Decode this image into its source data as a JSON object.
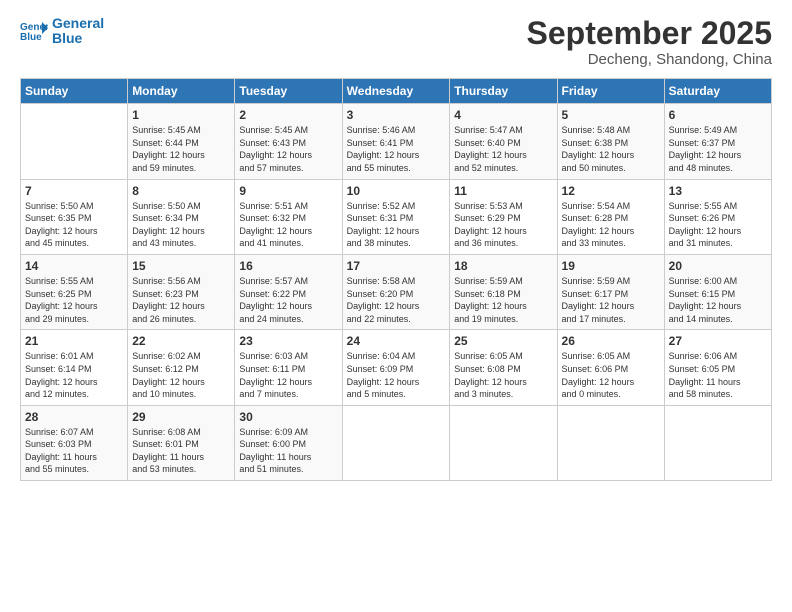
{
  "header": {
    "logo_line1": "General",
    "logo_line2": "Blue",
    "month": "September 2025",
    "location": "Decheng, Shandong, China"
  },
  "days_of_week": [
    "Sunday",
    "Monday",
    "Tuesday",
    "Wednesday",
    "Thursday",
    "Friday",
    "Saturday"
  ],
  "weeks": [
    [
      {
        "day": "",
        "info": ""
      },
      {
        "day": "1",
        "info": "Sunrise: 5:45 AM\nSunset: 6:44 PM\nDaylight: 12 hours\nand 59 minutes."
      },
      {
        "day": "2",
        "info": "Sunrise: 5:45 AM\nSunset: 6:43 PM\nDaylight: 12 hours\nand 57 minutes."
      },
      {
        "day": "3",
        "info": "Sunrise: 5:46 AM\nSunset: 6:41 PM\nDaylight: 12 hours\nand 55 minutes."
      },
      {
        "day": "4",
        "info": "Sunrise: 5:47 AM\nSunset: 6:40 PM\nDaylight: 12 hours\nand 52 minutes."
      },
      {
        "day": "5",
        "info": "Sunrise: 5:48 AM\nSunset: 6:38 PM\nDaylight: 12 hours\nand 50 minutes."
      },
      {
        "day": "6",
        "info": "Sunrise: 5:49 AM\nSunset: 6:37 PM\nDaylight: 12 hours\nand 48 minutes."
      }
    ],
    [
      {
        "day": "7",
        "info": "Sunrise: 5:50 AM\nSunset: 6:35 PM\nDaylight: 12 hours\nand 45 minutes."
      },
      {
        "day": "8",
        "info": "Sunrise: 5:50 AM\nSunset: 6:34 PM\nDaylight: 12 hours\nand 43 minutes."
      },
      {
        "day": "9",
        "info": "Sunrise: 5:51 AM\nSunset: 6:32 PM\nDaylight: 12 hours\nand 41 minutes."
      },
      {
        "day": "10",
        "info": "Sunrise: 5:52 AM\nSunset: 6:31 PM\nDaylight: 12 hours\nand 38 minutes."
      },
      {
        "day": "11",
        "info": "Sunrise: 5:53 AM\nSunset: 6:29 PM\nDaylight: 12 hours\nand 36 minutes."
      },
      {
        "day": "12",
        "info": "Sunrise: 5:54 AM\nSunset: 6:28 PM\nDaylight: 12 hours\nand 33 minutes."
      },
      {
        "day": "13",
        "info": "Sunrise: 5:55 AM\nSunset: 6:26 PM\nDaylight: 12 hours\nand 31 minutes."
      }
    ],
    [
      {
        "day": "14",
        "info": "Sunrise: 5:55 AM\nSunset: 6:25 PM\nDaylight: 12 hours\nand 29 minutes."
      },
      {
        "day": "15",
        "info": "Sunrise: 5:56 AM\nSunset: 6:23 PM\nDaylight: 12 hours\nand 26 minutes."
      },
      {
        "day": "16",
        "info": "Sunrise: 5:57 AM\nSunset: 6:22 PM\nDaylight: 12 hours\nand 24 minutes."
      },
      {
        "day": "17",
        "info": "Sunrise: 5:58 AM\nSunset: 6:20 PM\nDaylight: 12 hours\nand 22 minutes."
      },
      {
        "day": "18",
        "info": "Sunrise: 5:59 AM\nSunset: 6:18 PM\nDaylight: 12 hours\nand 19 minutes."
      },
      {
        "day": "19",
        "info": "Sunrise: 5:59 AM\nSunset: 6:17 PM\nDaylight: 12 hours\nand 17 minutes."
      },
      {
        "day": "20",
        "info": "Sunrise: 6:00 AM\nSunset: 6:15 PM\nDaylight: 12 hours\nand 14 minutes."
      }
    ],
    [
      {
        "day": "21",
        "info": "Sunrise: 6:01 AM\nSunset: 6:14 PM\nDaylight: 12 hours\nand 12 minutes."
      },
      {
        "day": "22",
        "info": "Sunrise: 6:02 AM\nSunset: 6:12 PM\nDaylight: 12 hours\nand 10 minutes."
      },
      {
        "day": "23",
        "info": "Sunrise: 6:03 AM\nSunset: 6:11 PM\nDaylight: 12 hours\nand 7 minutes."
      },
      {
        "day": "24",
        "info": "Sunrise: 6:04 AM\nSunset: 6:09 PM\nDaylight: 12 hours\nand 5 minutes."
      },
      {
        "day": "25",
        "info": "Sunrise: 6:05 AM\nSunset: 6:08 PM\nDaylight: 12 hours\nand 3 minutes."
      },
      {
        "day": "26",
        "info": "Sunrise: 6:05 AM\nSunset: 6:06 PM\nDaylight: 12 hours\nand 0 minutes."
      },
      {
        "day": "27",
        "info": "Sunrise: 6:06 AM\nSunset: 6:05 PM\nDaylight: 11 hours\nand 58 minutes."
      }
    ],
    [
      {
        "day": "28",
        "info": "Sunrise: 6:07 AM\nSunset: 6:03 PM\nDaylight: 11 hours\nand 55 minutes."
      },
      {
        "day": "29",
        "info": "Sunrise: 6:08 AM\nSunset: 6:01 PM\nDaylight: 11 hours\nand 53 minutes."
      },
      {
        "day": "30",
        "info": "Sunrise: 6:09 AM\nSunset: 6:00 PM\nDaylight: 11 hours\nand 51 minutes."
      },
      {
        "day": "",
        "info": ""
      },
      {
        "day": "",
        "info": ""
      },
      {
        "day": "",
        "info": ""
      },
      {
        "day": "",
        "info": ""
      }
    ]
  ]
}
